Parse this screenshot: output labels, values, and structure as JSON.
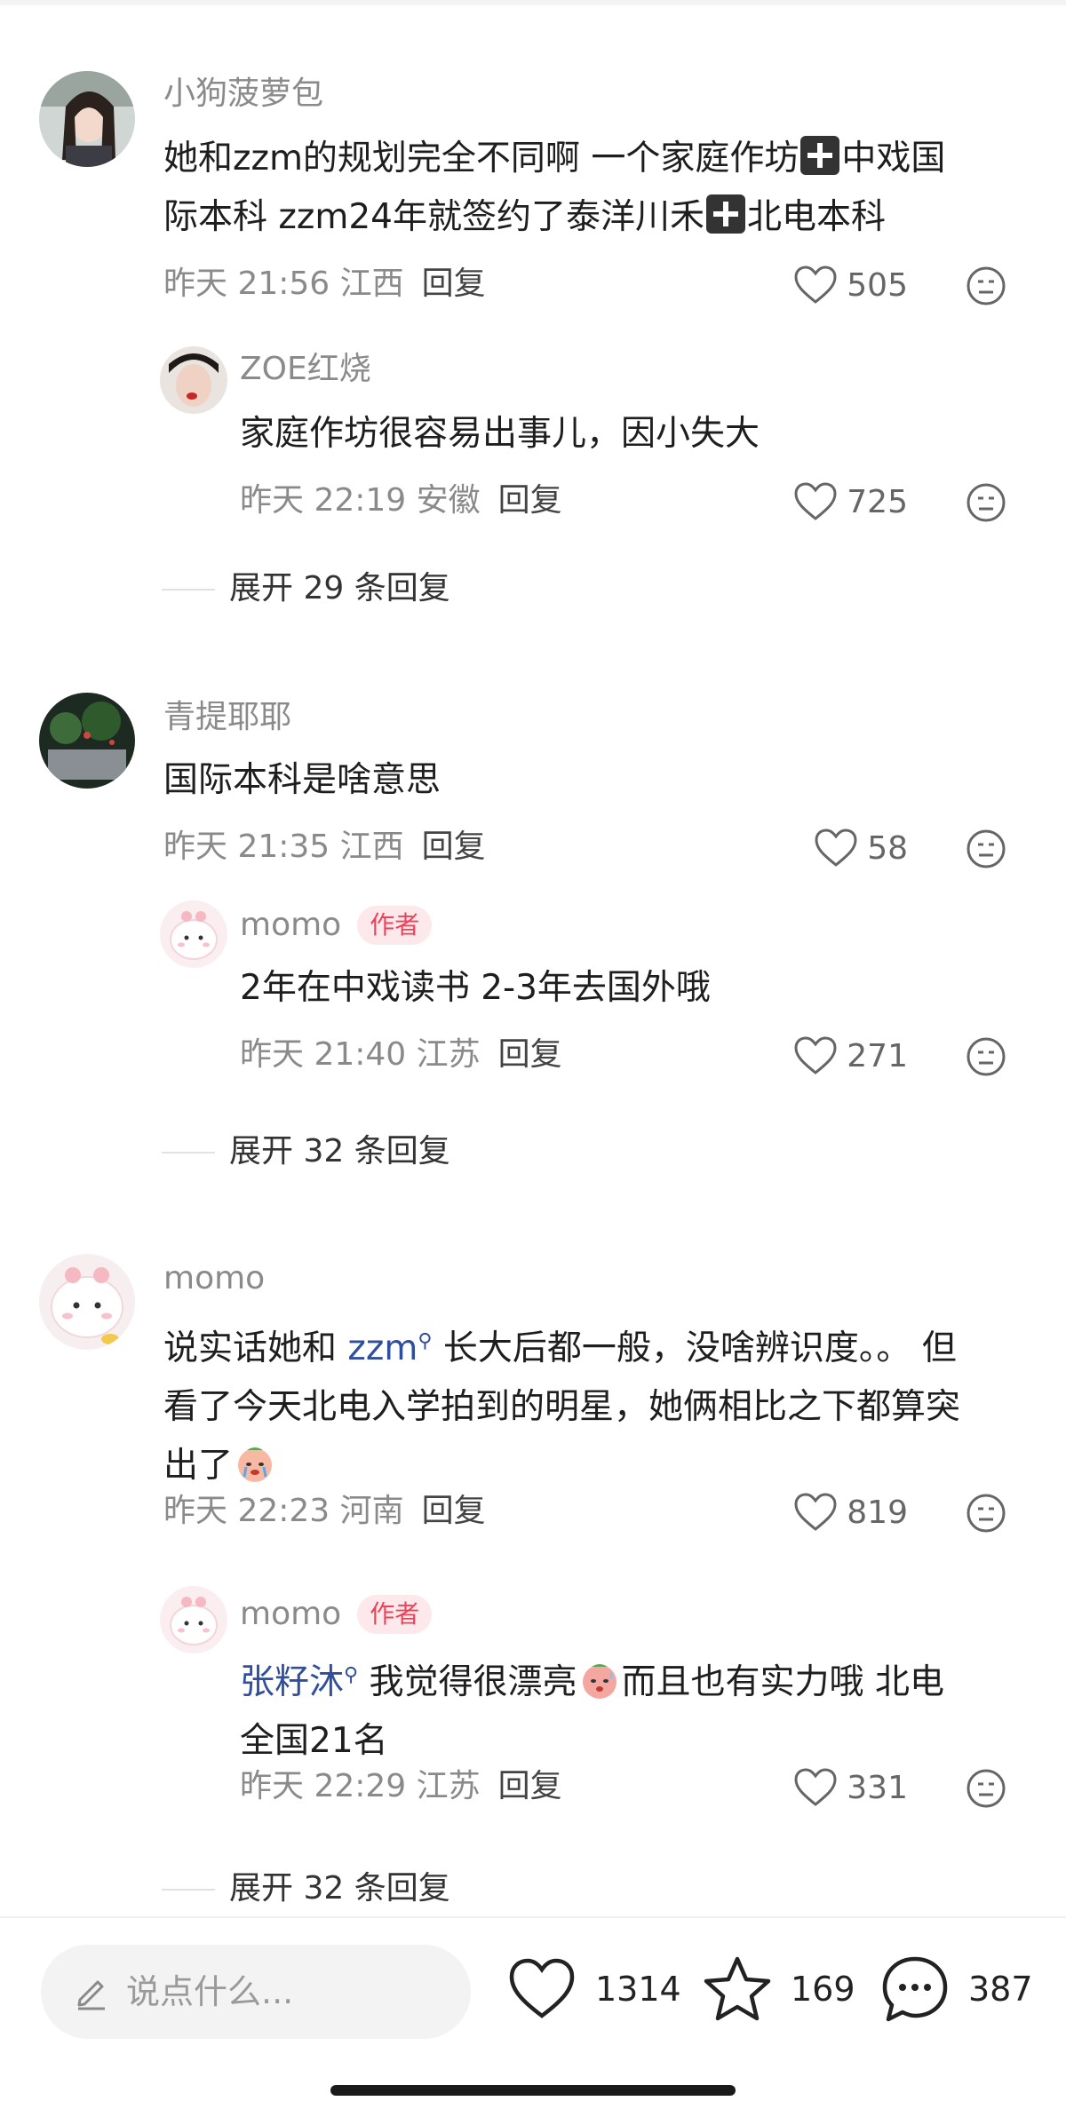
{
  "comments": [
    {
      "user": "小狗菠萝包",
      "text_parts": [
        "她和zzm的规划完全不同啊 一个家庭作坊",
        "中戏国",
        "际本科 zzm24年就签约了泰洋川禾",
        "北电本科"
      ],
      "time": "昨天 21:56",
      "location": "江西",
      "reply_label": "回复",
      "likes": "505",
      "reply": {
        "user": "ZOE红烧",
        "text": "家庭作坊很容易出事儿，因小失大",
        "time": "昨天 22:19",
        "location": "安徽",
        "reply_label": "回复",
        "likes": "725"
      },
      "expand": "展开 29 条回复"
    },
    {
      "user": "青提耶耶",
      "text": "国际本科是啥意思",
      "time": "昨天 21:35",
      "location": "江西",
      "reply_label": "回复",
      "likes": "58",
      "reply": {
        "user": "momo",
        "badge": "作者",
        "text": "2年在中戏读书 2-3年去国外哦",
        "time": "昨天 21:40",
        "location": "江苏",
        "reply_label": "回复",
        "likes": "271"
      },
      "expand": "展开 32 条回复"
    },
    {
      "user": "momo",
      "line1_a": "说实话她和 ",
      "mention": "zzm",
      "line1_b": " 长大后都一般，没啥辨识度。。 但",
      "line2": "看了今天北电入学拍到的明星，她俩相比之下都算突",
      "line3": "出了",
      "time": "昨天 22:23",
      "location": "河南",
      "reply_label": "回复",
      "likes": "819",
      "reply": {
        "user": "momo",
        "badge": "作者",
        "mention": "张籽沐",
        "text_a": " 我觉得很漂亮",
        "text_b": "而且也有实力哦 北电",
        "text_c": "全国21名",
        "time": "昨天 22:29",
        "location": "江苏",
        "reply_label": "回复",
        "likes": "331"
      },
      "expand": "展开 32 条回复"
    }
  ],
  "bottom_bar": {
    "placeholder": "说点什么...",
    "likes": "1314",
    "favorites": "169",
    "comments": "387"
  }
}
